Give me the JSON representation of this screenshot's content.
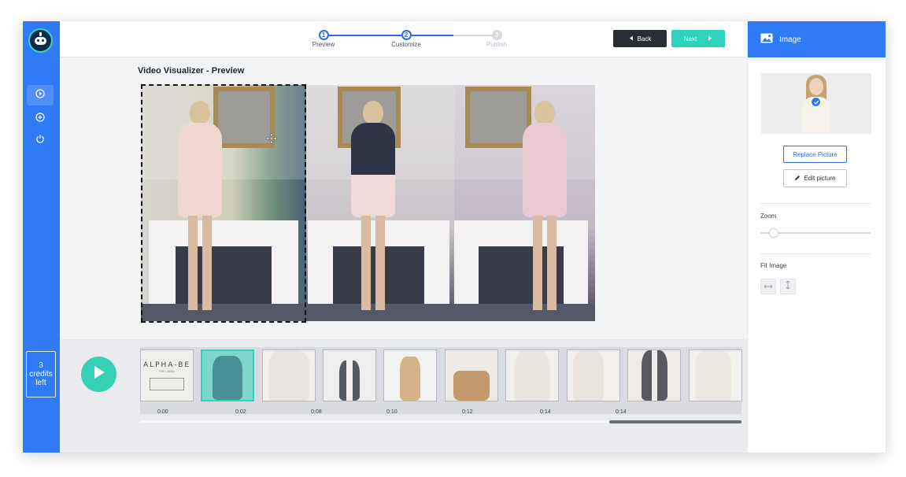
{
  "app": {
    "logo_icon": "robot-logo-icon",
    "brand_color": "#2f7bf5",
    "accent_color": "#34d1b6"
  },
  "sidebar": {
    "items": [
      {
        "icon": "play-circle-icon",
        "active": true
      },
      {
        "icon": "plus-circle-icon",
        "active": false
      },
      {
        "icon": "power-icon",
        "active": false
      }
    ],
    "credits_number": "3",
    "credits_line1": "credits",
    "credits_line2": "left"
  },
  "steps": [
    {
      "number": "1",
      "label": "Preview",
      "state": "done"
    },
    {
      "number": "2",
      "label": "Customize",
      "state": "active"
    },
    {
      "number": "3",
      "label": "Publish",
      "state": "disabled"
    }
  ],
  "toolbar": {
    "back_label": "Back",
    "next_label": "Next"
  },
  "main": {
    "title": "Video Visualizer - Preview"
  },
  "timeline": {
    "play_icon": "play-icon",
    "thumbnails": [
      {
        "kind": "logo",
        "logo_text": "ALPHA-BE",
        "logo_sub": "THE LABEL",
        "selected": false
      },
      {
        "kind": "photo",
        "selected": true
      },
      {
        "kind": "photo",
        "selected": false
      },
      {
        "kind": "photo",
        "selected": false
      },
      {
        "kind": "photo",
        "selected": false
      },
      {
        "kind": "photo",
        "selected": false
      },
      {
        "kind": "photo",
        "selected": false
      },
      {
        "kind": "photo",
        "selected": false
      },
      {
        "kind": "photo",
        "selected": false
      },
      {
        "kind": "photo",
        "selected": false
      }
    ],
    "time_labels": [
      "0:00",
      "0:02",
      "0:08",
      "0:10",
      "0:12",
      "0:14",
      "0:14"
    ],
    "scroll_position": 0.78
  },
  "panel": {
    "title": "Image",
    "title_icon": "image-icon",
    "replace_label": "Replace Picture",
    "edit_label": "Edit picture",
    "zoom_label": "Zoom",
    "zoom_value": 0.1,
    "fit_label": "Fit Image",
    "fit_buttons": [
      "fit-width-icon",
      "fit-height-icon"
    ]
  }
}
